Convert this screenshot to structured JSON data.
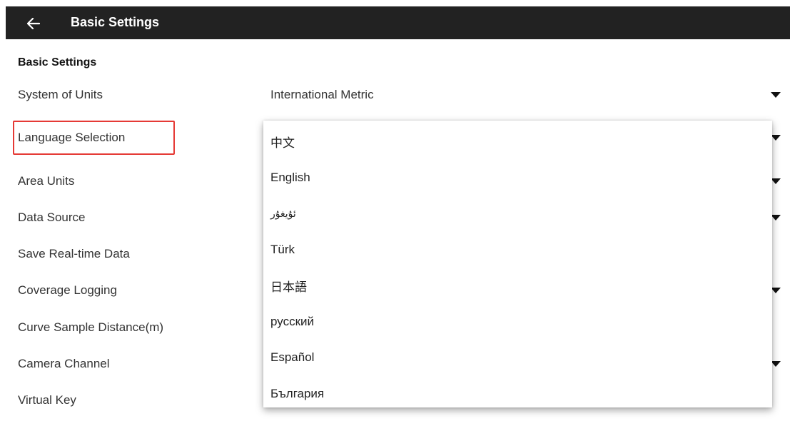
{
  "header": {
    "title": "Basic Settings",
    "back_icon": "arrow-left-icon"
  },
  "section": {
    "title": "Basic Settings"
  },
  "settings": [
    {
      "label": "System of Units",
      "value": "International Metric",
      "has_dropdown": true
    },
    {
      "label": "Language Selection",
      "value": "",
      "has_dropdown": true,
      "highlighted": true
    },
    {
      "label": "Area Units",
      "value": "",
      "has_dropdown": true
    },
    {
      "label": "Data Source",
      "value": "",
      "has_dropdown": true
    },
    {
      "label": "Save Real-time Data",
      "value": "",
      "has_dropdown": false
    },
    {
      "label": "Coverage Logging",
      "value": "",
      "has_dropdown": true
    },
    {
      "label": "Curve Sample Distance(m)",
      "value": "",
      "has_dropdown": false
    },
    {
      "label": "Camera Channel",
      "value": "",
      "has_dropdown": true
    },
    {
      "label": "Virtual Key",
      "value": "",
      "has_dropdown": false
    }
  ],
  "language_menu": {
    "options": [
      "中文",
      "English",
      "ئۇيغۇر",
      "Türk",
      "日本語",
      "русский",
      "Español",
      "България"
    ]
  },
  "colors": {
    "header_bg": "#222222",
    "highlight": "#e53935"
  }
}
